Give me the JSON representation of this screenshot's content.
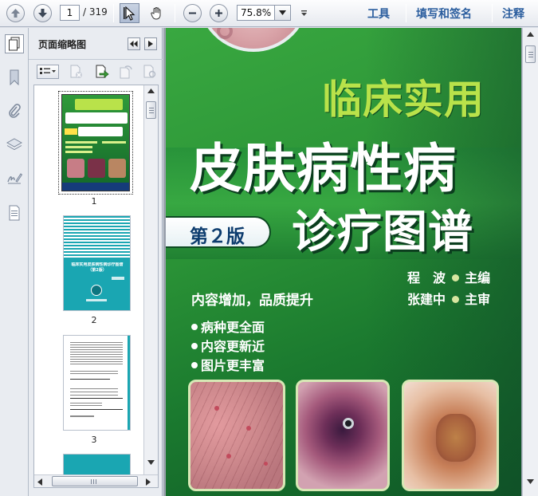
{
  "toolbar": {
    "page_current": "1",
    "page_total": "/ 319",
    "zoom_value": "75.8%",
    "menus": [
      {
        "label": "工具"
      },
      {
        "label": "填写和签名"
      },
      {
        "label": "注释"
      }
    ]
  },
  "thumb_panel": {
    "title": "页面缩略图",
    "thumbs": [
      {
        "label": "1"
      },
      {
        "label": "2"
      },
      {
        "label": "3"
      }
    ],
    "thumb2_title": "临床实用皮肤病性病诊疗图谱（第2版）"
  },
  "cover": {
    "title_line1": "临床实用",
    "title_line2": "皮肤病性病",
    "title_line3": "诊疗图谱",
    "edition": "第２版",
    "author1_name": "程　波",
    "author1_role": "主编",
    "author2_name": "张建中",
    "author2_role": "主审",
    "slogan": "内容增加，品质提升",
    "bullets": [
      "病种更全面",
      "内容更新近",
      "图片更丰富"
    ]
  },
  "colors": {
    "menu_text": "#2a5d9e",
    "cover_green": "#2f9a3a",
    "cover_dark": "#124f2c",
    "title_yellow": "#b9e24a"
  }
}
